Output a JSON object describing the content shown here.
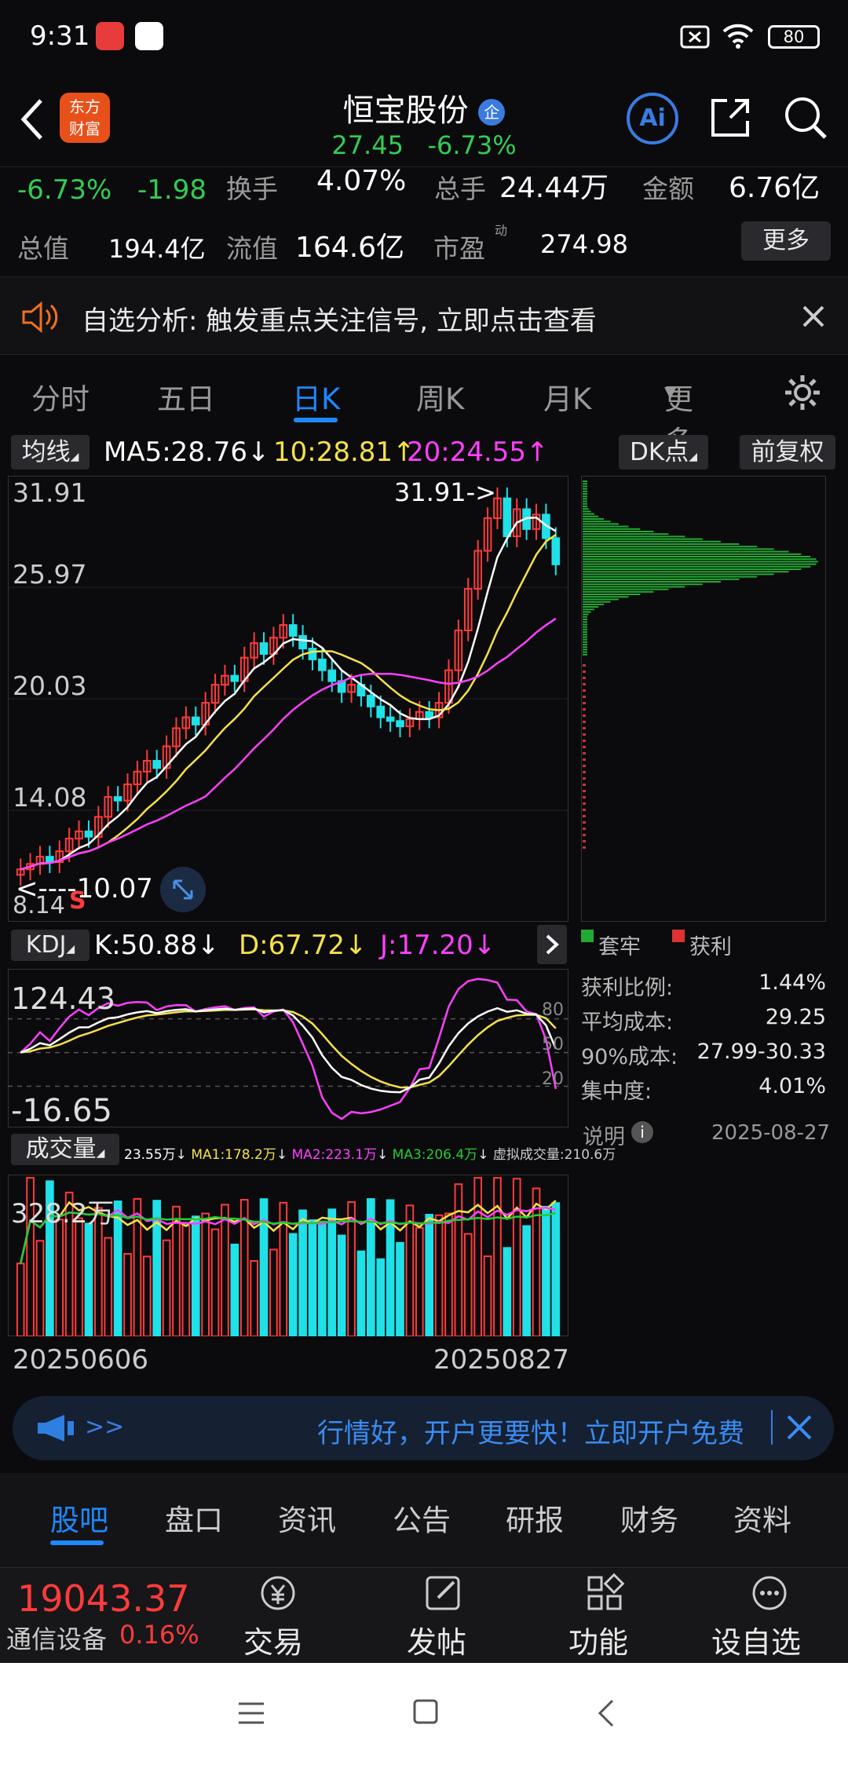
{
  "status": {
    "time": "9:31",
    "battery": "80"
  },
  "header": {
    "title": "恒宝股份",
    "badge": "企",
    "price": "27.45",
    "change_pct": "-6.73%"
  },
  "quote": {
    "pct": "-6.73%",
    "chg": "-1.98",
    "turnover_label": "换手",
    "turnover": "4.07%",
    "volume_label": "总手",
    "volume": "24.44万",
    "amount_label": "金额",
    "amount": "6.76亿",
    "mktcap_label": "总值",
    "mktcap": "194.4亿",
    "float_label": "流值",
    "float_cap": "164.6亿",
    "pe_label": "市盈",
    "pe_sup": "动",
    "pe": "274.98",
    "more": "更多"
  },
  "notice": {
    "text": "自选分析: 触发重点关注信号, 立即点击查看"
  },
  "period_tabs": [
    "分时",
    "五日",
    "日K",
    "周K",
    "月K",
    "更多"
  ],
  "ma_bar": {
    "label": "均线",
    "ma5": "MA5:28.76",
    "ma5_arrow": "↓",
    "ma10": "10:28.81",
    "ma10_arrow": "↑",
    "ma20": "20:24.55",
    "ma20_arrow": "↑",
    "dk": "DK点",
    "fq": "前复权"
  },
  "kline": {
    "y_labels": [
      "31.91",
      "25.97",
      "20.03",
      "14.08",
      "8.14"
    ],
    "high_note": "31.91->",
    "low_note": "<----10.07",
    "s_mark": "S"
  },
  "kdj": {
    "label": "KDJ",
    "k": "K:50.88",
    "k_arrow": "↓",
    "d": "D:67.72",
    "d_arrow": "↓",
    "j": "J:17.20",
    "j_arrow": "↓",
    "top": "124.43",
    "bottom": "-16.65",
    "lv80": "80",
    "lv50": "50",
    "lv20": "20"
  },
  "vol": {
    "label": "成交量",
    "v": "23.55万",
    "ma1": "MA1:178.2万",
    "ma2": "MA2:223.1万",
    "ma3": "MA3:206.4万",
    "virtual": "虚拟成交量:210.6万",
    "top": "328.2万",
    "d_start": "20250606",
    "d_end": "20250827"
  },
  "chip": {
    "legend_trap": "套牢",
    "legend_profit": "获利",
    "rows": [
      {
        "k": "获利比例:",
        "v": "1.44%"
      },
      {
        "k": "平均成本:",
        "v": "29.25"
      },
      {
        "k": "90%成本:",
        "v": "27.99-30.33"
      },
      {
        "k": "集中度:",
        "v": "4.01%"
      }
    ],
    "note": "说明",
    "date": "2025-08-27"
  },
  "promo": {
    "arrows": ">>",
    "text": "行情好，开户更要快！立即开户免费"
  },
  "sub_tabs": [
    "股吧",
    "盘口",
    "资讯",
    "公告",
    "研报",
    "财务",
    "资料"
  ],
  "bottom": {
    "index_value": "19043.37",
    "index_name": "通信设备",
    "index_pct": "0.16%",
    "trade": "交易",
    "post": "发帖",
    "func": "功能",
    "watch": "设自选"
  },
  "colors": {
    "up": "#ff3b3b",
    "down": "#20e0e8",
    "accent": "#1e88ff",
    "ma5": "#ffffff",
    "ma10": "#f5e14a",
    "ma20": "#ff40ff"
  },
  "chart_data": {
    "type": "candlestick",
    "x_range": [
      "20250606",
      "20250827"
    ],
    "ylim": [
      8.14,
      31.91
    ],
    "high": 31.91,
    "low": 10.07,
    "close": [
      10.6,
      10.9,
      11.3,
      11.0,
      11.6,
      12.3,
      12.7,
      12.4,
      13.5,
      14.6,
      14.4,
      15.3,
      16.0,
      16.6,
      16.2,
      17.4,
      18.4,
      19.0,
      18.6,
      19.8,
      20.8,
      21.3,
      21.0,
      22.3,
      23.1,
      22.5,
      23.4,
      24.1,
      23.5,
      22.8,
      22.2,
      21.6,
      21.0,
      20.4,
      20.8,
      20.2,
      19.6,
      19.0,
      18.8,
      18.5,
      18.9,
      19.3,
      19.0,
      19.8,
      21.6,
      23.8,
      26.1,
      28.2,
      30.0,
      31.1,
      29.0,
      30.5,
      29.4,
      30.2,
      28.9,
      27.45
    ]
  }
}
